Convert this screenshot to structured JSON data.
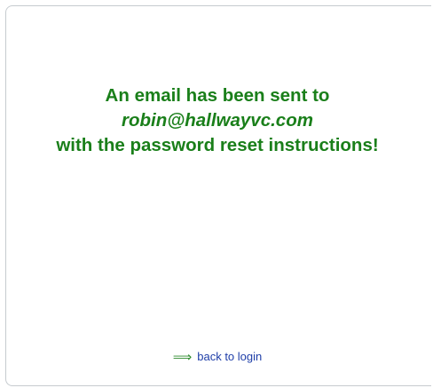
{
  "message": {
    "line1": "An email has been sent to",
    "email": "robin@hallwayvc.com",
    "line3": "with the password reset instructions!"
  },
  "back_link": {
    "icon": "right-arrow-icon",
    "label": "back to login"
  },
  "colors": {
    "message": "#1a7f1a",
    "link": "#1f3ea8",
    "arrow": "#2e8b2e",
    "border": "#c6cbcf"
  }
}
